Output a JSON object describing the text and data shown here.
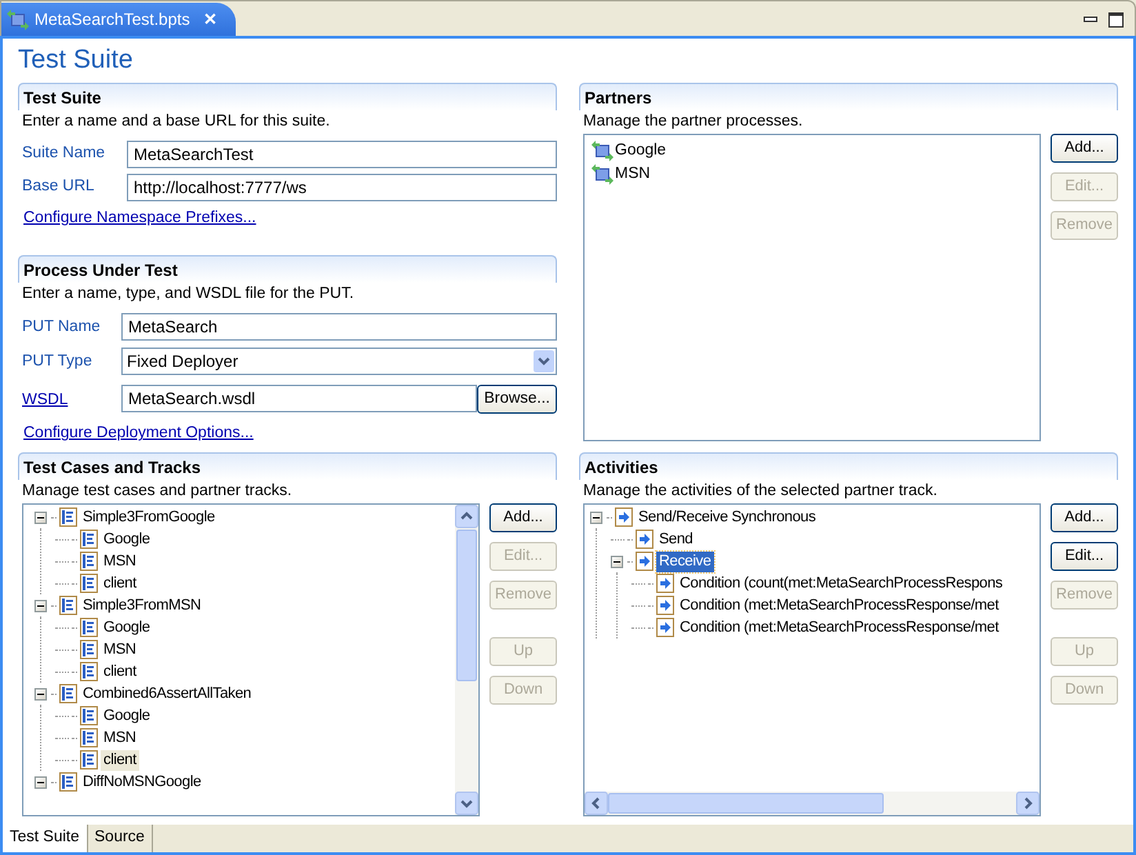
{
  "editor_tab": {
    "title": "MetaSearchTest.bpts",
    "close": "✕"
  },
  "page_title": "Test Suite",
  "test_suite": {
    "title": "Test Suite",
    "description": "Enter a name and a base URL for this suite.",
    "fields": [
      {
        "label": "Suite Name",
        "value": "MetaSearchTest"
      },
      {
        "label": "Base URL",
        "value": "http://localhost:7777/ws"
      }
    ],
    "link": "Configure Namespace Prefixes..."
  },
  "process_under_test": {
    "title": "Process Under Test",
    "description": "Enter a name, type, and WSDL file for the PUT.",
    "put_name": {
      "label": "PUT Name",
      "value": "MetaSearch"
    },
    "put_type": {
      "label": "PUT Type",
      "value": "Fixed Deployer"
    },
    "wsdl": {
      "label": "WSDL",
      "value": "MetaSearch.wsdl",
      "button": "Browse..."
    },
    "link": "Configure Deployment Options..."
  },
  "partners": {
    "title": "Partners",
    "description": "Manage the partner processes.",
    "items": [
      {
        "label": "Google"
      },
      {
        "label": "MSN"
      }
    ],
    "button_groups": [
      [
        {
          "label": "Add...",
          "disabled": false
        },
        {
          "label": "Edit...",
          "disabled": true
        },
        {
          "label": "Remove",
          "disabled": true
        }
      ]
    ]
  },
  "test_cases": {
    "title": "Test Cases and Tracks",
    "description": "Manage test cases and partner tracks.",
    "focused": false,
    "tree": [
      {
        "label": "Simple3FromGoogle",
        "expanded": true,
        "selected": false,
        "children": [
          {
            "label": "Google",
            "selected": false
          },
          {
            "label": "MSN",
            "selected": false
          },
          {
            "label": "client",
            "selected": false
          }
        ]
      },
      {
        "label": "Simple3FromMSN",
        "expanded": true,
        "selected": false,
        "children": [
          {
            "label": "Google",
            "selected": false
          },
          {
            "label": "MSN",
            "selected": false
          },
          {
            "label": "client",
            "selected": false
          }
        ]
      },
      {
        "label": "Combined6AssertAllTaken",
        "expanded": true,
        "selected": false,
        "children": [
          {
            "label": "Google",
            "selected": false
          },
          {
            "label": "MSN",
            "selected": false
          },
          {
            "label": "client",
            "selected": true
          }
        ]
      },
      {
        "label": "DiffNoMSNGoogle",
        "expanded": true,
        "selected": false
      }
    ],
    "button_groups": [
      [
        {
          "label": "Add...",
          "disabled": false
        },
        {
          "label": "Edit...",
          "disabled": true
        },
        {
          "label": "Remove",
          "disabled": true
        }
      ],
      [
        {
          "label": "Up",
          "disabled": true
        },
        {
          "label": "Down",
          "disabled": true
        }
      ]
    ]
  },
  "activities": {
    "title": "Activities",
    "description": "Manage the activities of the selected partner track.",
    "focused": true,
    "tree": [
      {
        "label": "Send/Receive Synchronous",
        "expanded": true,
        "selected": false,
        "children": [
          {
            "label": "Send",
            "selected": false
          },
          {
            "label": "Receive",
            "expanded": true,
            "selected": true,
            "children": [
              {
                "label": "Condition (count(met:MetaSearchProcessRespons",
                "selected": false
              },
              {
                "label": "Condition (met:MetaSearchProcessResponse/met",
                "selected": false
              },
              {
                "label": "Condition (met:MetaSearchProcessResponse/met",
                "selected": false
              }
            ]
          }
        ]
      }
    ],
    "button_groups": [
      [
        {
          "label": "Add...",
          "disabled": false
        },
        {
          "label": "Edit...",
          "disabled": false
        },
        {
          "label": "Remove",
          "disabled": true
        }
      ],
      [
        {
          "label": "Up",
          "disabled": true
        },
        {
          "label": "Down",
          "disabled": true
        }
      ]
    ]
  },
  "bottom_tabs": [
    {
      "label": "Test Suite",
      "selected": true
    },
    {
      "label": "Source",
      "selected": false
    }
  ]
}
